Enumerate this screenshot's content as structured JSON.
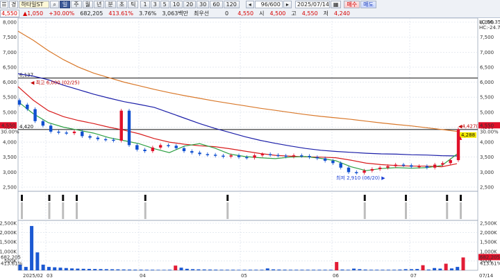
{
  "toolbar": {
    "row1": {
      "menu_icon": "stack-icon",
      "code_label": "경",
      "stock_name": "하타일ST",
      "period_buttons": [
        "일",
        "주",
        "월",
        "년",
        "분",
        "초",
        "틱"
      ],
      "interval_buttons": [
        "1",
        "3",
        "5",
        "10",
        "20",
        "30",
        "60",
        "120"
      ],
      "count_display": "96/600",
      "date_value": "2025/07/14",
      "buy_label": "매수",
      "sell_label": "매도"
    },
    "row2": {
      "price": "4,550",
      "change": "▲1,050",
      "change_pct": "+30.00%",
      "volume": "682,205",
      "vol_ratio": "413.61%",
      "turnover": "3.76%",
      "amount": "3,063백만",
      "pref_label": "최우선",
      "pref_value": "0",
      "open_value": "4,550",
      "label_si": "시",
      "si_value": "4,500",
      "label_go": "고",
      "go_value": "4,550",
      "label_jeo": "저",
      "jeo_value": "4,240"
    }
  },
  "colors": {
    "up": "#e0102a",
    "down": "#1050d0",
    "ma_short": "#2ea043",
    "ma_mid": "#d81c1c",
    "ma_long": "#1b1ea8",
    "ma_longest": "#d9782a",
    "vol_bar": "#bdbdbd",
    "grid": "#d6dde8"
  },
  "chart_data": {
    "type": "candlestick",
    "price_axis": {
      "range": [
        2500,
        8000
      ],
      "ticks": [
        "8,000",
        "7,500",
        "7,000",
        "6,500",
        "6,000",
        "5,500",
        "5,000",
        "4,500",
        "4,000",
        "3,500",
        "3,000",
        "2,500"
      ],
      "current_price_label": "4,550",
      "current_pct_label": "30.00%",
      "top_right_labels": [
        "LC:56.35",
        "HC:-24.79"
      ]
    },
    "x_axis": {
      "labels": [
        "2025/02",
        "03",
        "04",
        "05",
        "06",
        "07"
      ],
      "end_label": "07/14"
    },
    "horizontal_lines": [
      {
        "value": 6137,
        "label": "6,137"
      },
      {
        "value": 4420,
        "label": "4,420"
      }
    ],
    "annotations": [
      {
        "text": "최고 6,000 (02/25)",
        "value": 6000
      },
      {
        "text": "최저 2,910 (06/20)",
        "value": 2910
      },
      {
        "text": "4,427(",
        "value": 4427
      },
      {
        "text": "4,288",
        "value": 4288
      }
    ],
    "ma_longest": [
      7700,
      7400,
      7050,
      6750,
      6500,
      6300,
      6150,
      6000,
      5880,
      5760,
      5650,
      5550,
      5460,
      5370,
      5290,
      5210,
      5130,
      5060,
      4990,
      4920,
      4860,
      4810,
      4760,
      4700,
      4640,
      4590,
      4540,
      4480,
      4420,
      4360
    ],
    "ma_long": [
      6280,
      6200,
      6080,
      5900,
      5750,
      5600,
      5470,
      5350,
      5260,
      5160,
      4980,
      4800,
      4620,
      4460,
      4320,
      4180,
      4060,
      3960,
      3870,
      3790,
      3730,
      3690,
      3660,
      3630,
      3610,
      3600,
      3580,
      3570,
      3550,
      3540
    ],
    "ma_mid": [
      5850,
      5400,
      5050,
      4850,
      4720,
      4620,
      4500,
      4400,
      4280,
      4120,
      4000,
      3930,
      3880,
      3850,
      3780,
      3700,
      3620,
      3560,
      3530,
      3510,
      3500,
      3480,
      3400,
      3300,
      3250,
      3220,
      3200,
      3200,
      3180,
      3280
    ],
    "ma_short": [
      5350,
      4950,
      4650,
      4500,
      4400,
      4300,
      4150,
      4050,
      3950,
      3780,
      3650,
      3870,
      3950,
      3800,
      3600,
      3520,
      3480,
      3450,
      3500,
      3520,
      3460,
      3380,
      3180,
      3050,
      3120,
      3150,
      3130,
      3150,
      3220,
      3600
    ],
    "candles": [
      5250,
      5100,
      4700,
      4550,
      4350,
      4320,
      4300,
      4350,
      4200,
      4150,
      4100,
      4080,
      4050,
      5050,
      3900,
      3750,
      3700,
      3820,
      3900,
      3880,
      3800,
      3700,
      3650,
      3600,
      3580,
      3550,
      3520,
      3560,
      3500,
      3480,
      3560,
      3600,
      3570,
      3550,
      3520,
      3560,
      3540,
      3500,
      3460,
      3380,
      3300,
      3150,
      3000,
      2980,
      3050,
      3100,
      3150,
      3200,
      3250,
      3230,
      3180,
      3200,
      3150,
      3250,
      3300,
      3400,
      4427
    ],
    "trade_signals": [
      1,
      0,
      1,
      1,
      1,
      0,
      0,
      0,
      0,
      1,
      0,
      0,
      0,
      0,
      0,
      1,
      0,
      0,
      0,
      0,
      0,
      0,
      0,
      0,
      0,
      1,
      0,
      0,
      1,
      0,
      0,
      1,
      1
    ],
    "volume_axis": {
      "range": [
        0,
        2500
      ],
      "ticks": [
        "2,500K",
        "2,000K",
        "1,500K",
        "1,000K",
        "500K"
      ],
      "current_label": "682,205",
      "ratio_label": "413.61%"
    },
    "volumes": [
      300,
      180,
      2350,
      950,
      300,
      180,
      160,
      140,
      120,
      100,
      90,
      80,
      75,
      70,
      65,
      60,
      55,
      50,
      45,
      40,
      35,
      35,
      30,
      30,
      25,
      25,
      30,
      250,
      140,
      80,
      60,
      50,
      45,
      40,
      35,
      30,
      30,
      30,
      25,
      25,
      30,
      30,
      30,
      100,
      50,
      40,
      35,
      30,
      30,
      30,
      30,
      30,
      30,
      30,
      30,
      440,
      40,
      30,
      90,
      60,
      40,
      30,
      30,
      30,
      30,
      30,
      40,
      60,
      60,
      70,
      270,
      40,
      120,
      90,
      350,
      100,
      180,
      682
    ]
  }
}
